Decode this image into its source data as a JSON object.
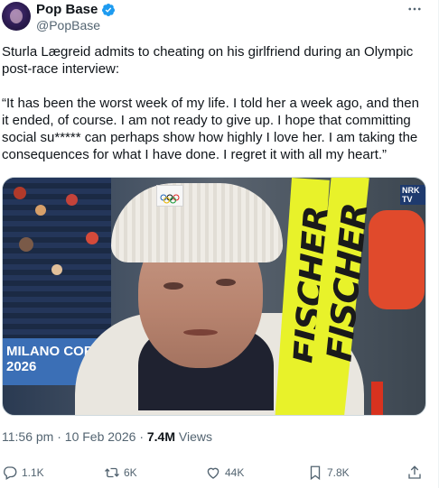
{
  "author": {
    "name": "Pop Base",
    "handle": "@PopBase"
  },
  "tweet": {
    "intro": "Sturla Lægreid admits to cheating on his girlfriend during an Olympic post-race interview:",
    "quote": "“It has been the worst week of my life. I told her a week ago, and then it ended, of course. I am not ready to give up. I hope that committing social su***** can perhaps show how highly I love her. I am taking the consequences for what I have done. I regret it with all my heart.”"
  },
  "media": {
    "banner_line1": "MILANO COR",
    "banner_line2": "2026",
    "ski_text": "FISCHER",
    "broadcaster": "NRK TV"
  },
  "meta": {
    "time": "11:56 pm",
    "separator": "·",
    "date": "10 Feb 2026",
    "views_count": "7.4M",
    "views_label": "Views"
  },
  "actions": {
    "replies": "1.1K",
    "reposts": "6K",
    "likes": "44K",
    "bookmarks": "7.8K"
  },
  "colors": {
    "verified": "#1d9bf0",
    "secondary_text": "#536471",
    "primary_text": "#0f1419"
  },
  "icons": {
    "more": "more-icon",
    "reply": "reply-icon",
    "repost": "repost-icon",
    "like": "heart-icon",
    "bookmark": "bookmark-icon",
    "share": "share-icon"
  }
}
